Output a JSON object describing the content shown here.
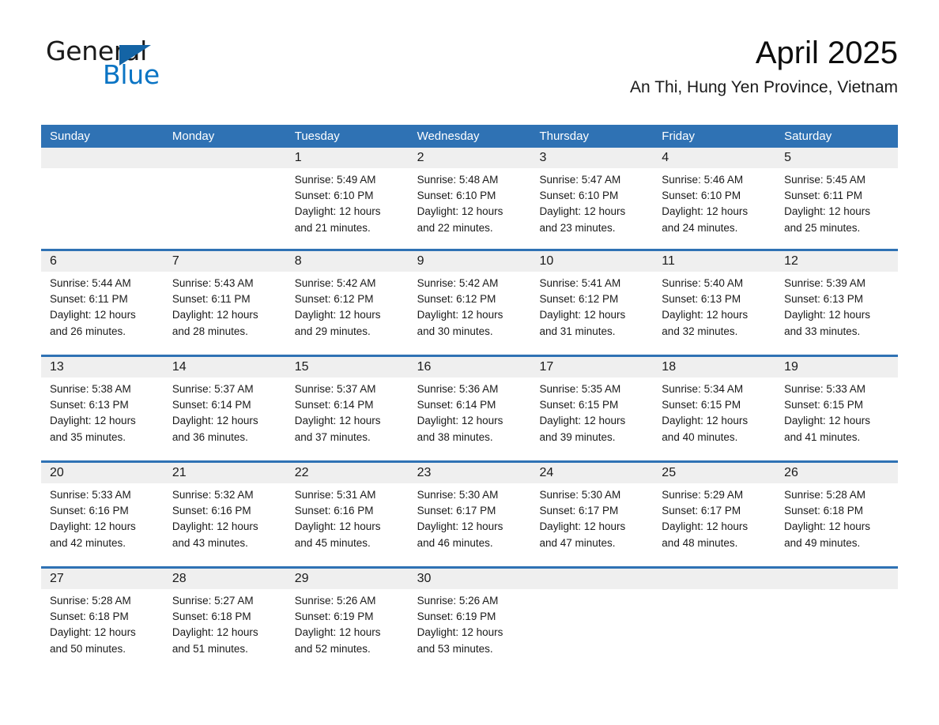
{
  "brand": {
    "name_part1": "General",
    "name_part2": "Blue",
    "accent_color": "#0a74c4",
    "triangle_color": "#1464a5"
  },
  "header": {
    "title": "April 2025",
    "subtitle": "An Thi, Hung Yen Province, Vietnam"
  },
  "calendar": {
    "header_bg": "#2f72b4",
    "header_text_color": "#ffffff",
    "daynum_band_bg": "#efefef",
    "weekday_headers": [
      "Sunday",
      "Monday",
      "Tuesday",
      "Wednesday",
      "Thursday",
      "Friday",
      "Saturday"
    ],
    "weeks": [
      [
        {
          "day": "",
          "lines": []
        },
        {
          "day": "",
          "lines": []
        },
        {
          "day": "1",
          "lines": [
            "Sunrise: 5:49 AM",
            "Sunset: 6:10 PM",
            "Daylight: 12 hours",
            "and 21 minutes."
          ]
        },
        {
          "day": "2",
          "lines": [
            "Sunrise: 5:48 AM",
            "Sunset: 6:10 PM",
            "Daylight: 12 hours",
            "and 22 minutes."
          ]
        },
        {
          "day": "3",
          "lines": [
            "Sunrise: 5:47 AM",
            "Sunset: 6:10 PM",
            "Daylight: 12 hours",
            "and 23 minutes."
          ]
        },
        {
          "day": "4",
          "lines": [
            "Sunrise: 5:46 AM",
            "Sunset: 6:10 PM",
            "Daylight: 12 hours",
            "and 24 minutes."
          ]
        },
        {
          "day": "5",
          "lines": [
            "Sunrise: 5:45 AM",
            "Sunset: 6:11 PM",
            "Daylight: 12 hours",
            "and 25 minutes."
          ]
        }
      ],
      [
        {
          "day": "6",
          "lines": [
            "Sunrise: 5:44 AM",
            "Sunset: 6:11 PM",
            "Daylight: 12 hours",
            "and 26 minutes."
          ]
        },
        {
          "day": "7",
          "lines": [
            "Sunrise: 5:43 AM",
            "Sunset: 6:11 PM",
            "Daylight: 12 hours",
            "and 28 minutes."
          ]
        },
        {
          "day": "8",
          "lines": [
            "Sunrise: 5:42 AM",
            "Sunset: 6:12 PM",
            "Daylight: 12 hours",
            "and 29 minutes."
          ]
        },
        {
          "day": "9",
          "lines": [
            "Sunrise: 5:42 AM",
            "Sunset: 6:12 PM",
            "Daylight: 12 hours",
            "and 30 minutes."
          ]
        },
        {
          "day": "10",
          "lines": [
            "Sunrise: 5:41 AM",
            "Sunset: 6:12 PM",
            "Daylight: 12 hours",
            "and 31 minutes."
          ]
        },
        {
          "day": "11",
          "lines": [
            "Sunrise: 5:40 AM",
            "Sunset: 6:13 PM",
            "Daylight: 12 hours",
            "and 32 minutes."
          ]
        },
        {
          "day": "12",
          "lines": [
            "Sunrise: 5:39 AM",
            "Sunset: 6:13 PM",
            "Daylight: 12 hours",
            "and 33 minutes."
          ]
        }
      ],
      [
        {
          "day": "13",
          "lines": [
            "Sunrise: 5:38 AM",
            "Sunset: 6:13 PM",
            "Daylight: 12 hours",
            "and 35 minutes."
          ]
        },
        {
          "day": "14",
          "lines": [
            "Sunrise: 5:37 AM",
            "Sunset: 6:14 PM",
            "Daylight: 12 hours",
            "and 36 minutes."
          ]
        },
        {
          "day": "15",
          "lines": [
            "Sunrise: 5:37 AM",
            "Sunset: 6:14 PM",
            "Daylight: 12 hours",
            "and 37 minutes."
          ]
        },
        {
          "day": "16",
          "lines": [
            "Sunrise: 5:36 AM",
            "Sunset: 6:14 PM",
            "Daylight: 12 hours",
            "and 38 minutes."
          ]
        },
        {
          "day": "17",
          "lines": [
            "Sunrise: 5:35 AM",
            "Sunset: 6:15 PM",
            "Daylight: 12 hours",
            "and 39 minutes."
          ]
        },
        {
          "day": "18",
          "lines": [
            "Sunrise: 5:34 AM",
            "Sunset: 6:15 PM",
            "Daylight: 12 hours",
            "and 40 minutes."
          ]
        },
        {
          "day": "19",
          "lines": [
            "Sunrise: 5:33 AM",
            "Sunset: 6:15 PM",
            "Daylight: 12 hours",
            "and 41 minutes."
          ]
        }
      ],
      [
        {
          "day": "20",
          "lines": [
            "Sunrise: 5:33 AM",
            "Sunset: 6:16 PM",
            "Daylight: 12 hours",
            "and 42 minutes."
          ]
        },
        {
          "day": "21",
          "lines": [
            "Sunrise: 5:32 AM",
            "Sunset: 6:16 PM",
            "Daylight: 12 hours",
            "and 43 minutes."
          ]
        },
        {
          "day": "22",
          "lines": [
            "Sunrise: 5:31 AM",
            "Sunset: 6:16 PM",
            "Daylight: 12 hours",
            "and 45 minutes."
          ]
        },
        {
          "day": "23",
          "lines": [
            "Sunrise: 5:30 AM",
            "Sunset: 6:17 PM",
            "Daylight: 12 hours",
            "and 46 minutes."
          ]
        },
        {
          "day": "24",
          "lines": [
            "Sunrise: 5:30 AM",
            "Sunset: 6:17 PM",
            "Daylight: 12 hours",
            "and 47 minutes."
          ]
        },
        {
          "day": "25",
          "lines": [
            "Sunrise: 5:29 AM",
            "Sunset: 6:17 PM",
            "Daylight: 12 hours",
            "and 48 minutes."
          ]
        },
        {
          "day": "26",
          "lines": [
            "Sunrise: 5:28 AM",
            "Sunset: 6:18 PM",
            "Daylight: 12 hours",
            "and 49 minutes."
          ]
        }
      ],
      [
        {
          "day": "27",
          "lines": [
            "Sunrise: 5:28 AM",
            "Sunset: 6:18 PM",
            "Daylight: 12 hours",
            "and 50 minutes."
          ]
        },
        {
          "day": "28",
          "lines": [
            "Sunrise: 5:27 AM",
            "Sunset: 6:18 PM",
            "Daylight: 12 hours",
            "and 51 minutes."
          ]
        },
        {
          "day": "29",
          "lines": [
            "Sunrise: 5:26 AM",
            "Sunset: 6:19 PM",
            "Daylight: 12 hours",
            "and 52 minutes."
          ]
        },
        {
          "day": "30",
          "lines": [
            "Sunrise: 5:26 AM",
            "Sunset: 6:19 PM",
            "Daylight: 12 hours",
            "and 53 minutes."
          ]
        },
        {
          "day": "",
          "lines": []
        },
        {
          "day": "",
          "lines": []
        },
        {
          "day": "",
          "lines": []
        }
      ]
    ]
  }
}
